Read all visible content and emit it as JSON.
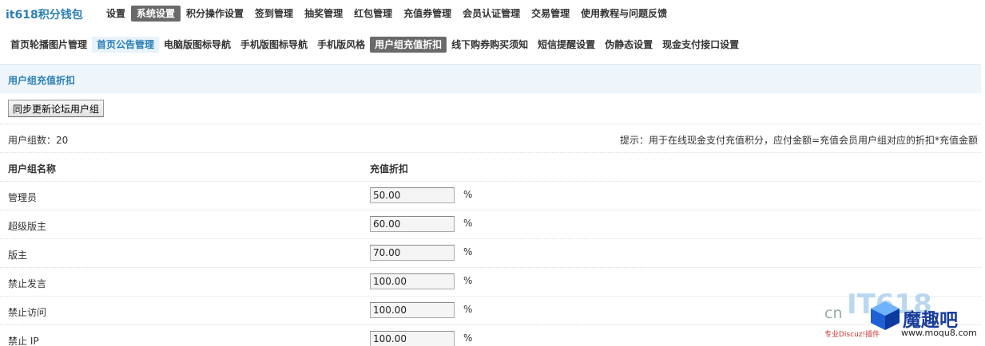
{
  "app": {
    "logo": "it618积分钱包"
  },
  "topnav": [
    "设置",
    "系统设置",
    "积分操作设置",
    "签到管理",
    "抽奖管理",
    "红包管理",
    "充值券管理",
    "会员认证管理",
    "交易管理",
    "使用教程与问题反馈"
  ],
  "subnav": [
    "首页轮播图片管理",
    "首页公告管理",
    "电脑版图标导航",
    "手机版图标导航",
    "手机版风格",
    "用户组充值折扣",
    "线下购券购买须知",
    "短信提醒设置",
    "伪静态设置",
    "现金支付接口设置"
  ],
  "section": {
    "title": "用户组充值折扣"
  },
  "toolbar": {
    "sync_label": "同步更新论坛用户组"
  },
  "summary": {
    "count_text": "用户组数：20",
    "hint": "提示：用于在线现金支付充值积分，应付金额=充值会员用户组对应的折扣*充值金额"
  },
  "table": {
    "headers": [
      "用户组名称",
      "充值折扣"
    ],
    "percent_sign": "%",
    "rows": [
      {
        "name": "管理员",
        "value": "50.00"
      },
      {
        "name": "超级版主",
        "value": "60.00"
      },
      {
        "name": "版主",
        "value": "70.00"
      },
      {
        "name": "禁止发言",
        "value": "100.00"
      },
      {
        "name": "禁止访问",
        "value": "100.00"
      },
      {
        "name": "禁止 IP",
        "value": "100.00"
      }
    ]
  },
  "watermark": {
    "cn": "cn",
    "it": "IT618",
    "brand": "魔趣吧",
    "sub": "专业Discuz!插件",
    "url": "www.moqu8.com"
  },
  "colors": {
    "accent": "#2b7fb4",
    "active_tab": "#6a6a6a",
    "section_bg": "#eef6fc"
  }
}
